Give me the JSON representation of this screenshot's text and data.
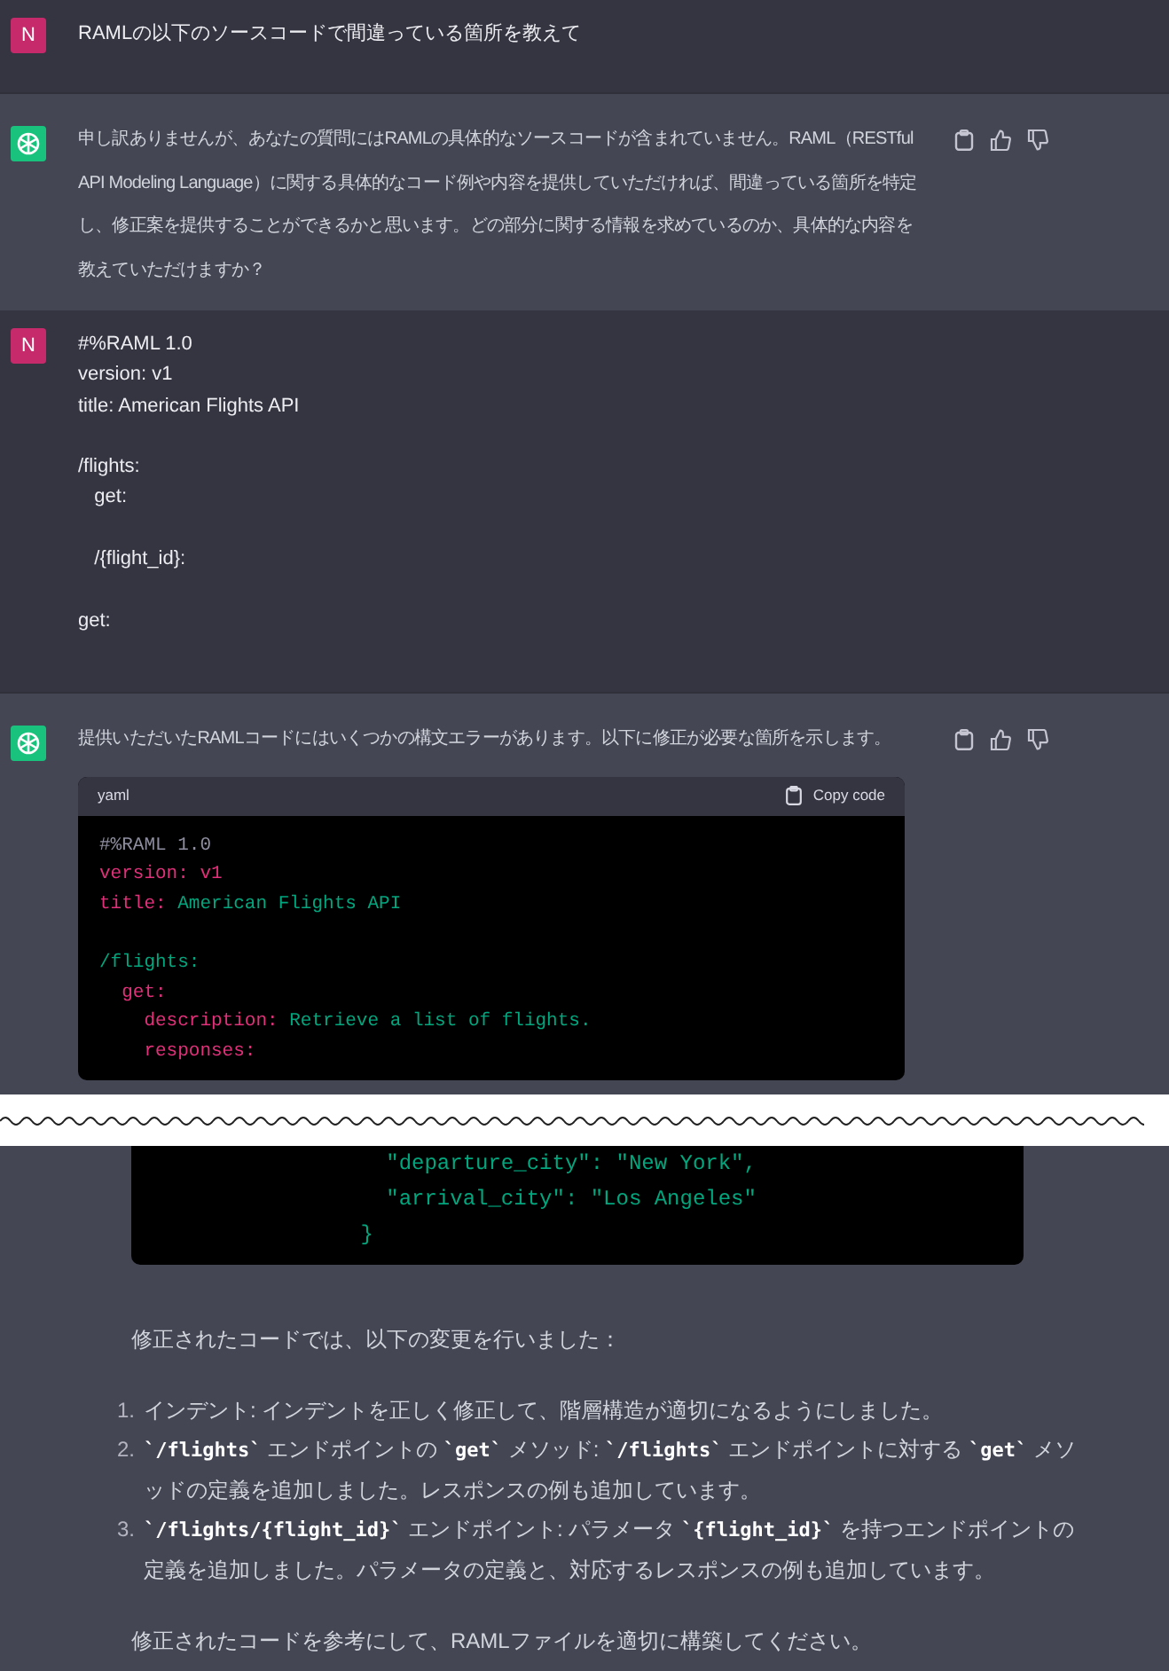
{
  "messages": [
    {
      "kind": "user",
      "avatar_letter": "N",
      "text": "RAMLの以下のソースコードで間違っている箇所を教えて"
    },
    {
      "kind": "assistant",
      "text": "申し訳ありませんが、あなたの質問にはRAMLの具体的なソースコードが含まれていません。RAML（RESTful API Modeling Language）に関する具体的なコード例や内容を提供していただければ、間違っている箇所を特定し、修正案を提供することができるかと思います。どの部分に関する情報を求めているのか、具体的な内容を教えていただけますか？"
    },
    {
      "kind": "user",
      "avatar_letter": "N",
      "text": "#%RAML 1.0\nversion: v1\ntitle: American Flights API\n\n/flights:\n   get:\n\n   /{flight_id}:\n\nget:"
    },
    {
      "kind": "assistant",
      "text": "提供いただいたRAMLコードにはいくつかの構文エラーがあります。以下に修正が必要な箇所を示します。",
      "code_block": {
        "language": "yaml",
        "copy_label": "Copy code",
        "lines": [
          {
            "tokens": [
              {
                "t": "#%RAML 1.0",
                "kind": "comment"
              }
            ]
          },
          {
            "tokens": [
              {
                "t": "version:",
                "kind": "key"
              },
              {
                "t": " v1",
                "kind": "key"
              }
            ]
          },
          {
            "tokens": [
              {
                "t": "title:",
                "kind": "key"
              },
              {
                "t": " American Flights API",
                "kind": "value"
              }
            ]
          },
          {
            "space_before": true,
            "tokens": [
              {
                "t": "/flights:",
                "kind": "value"
              }
            ]
          },
          {
            "tokens": [
              {
                "t": "  get:",
                "kind": "key"
              }
            ]
          },
          {
            "tokens": [
              {
                "t": "    description:",
                "kind": "key"
              },
              {
                "t": " Retrieve a list of flights.",
                "kind": "value"
              }
            ]
          },
          {
            "tokens": [
              {
                "t": "    responses:",
                "kind": "key"
              }
            ]
          }
        ]
      }
    }
  ],
  "continued": {
    "code_lines": [
      {
        "tokens": [
          {
            "t": "                  \"departure_city\": \"New York\",",
            "kind": "value"
          }
        ]
      },
      {
        "tokens": [
          {
            "t": "                  \"arrival_city\": \"Los Angeles\"",
            "kind": "value"
          }
        ]
      },
      {
        "tokens": [
          {
            "t": "                }",
            "kind": "value"
          }
        ]
      }
    ],
    "intro": "修正されたコードでは、以下の変更を行いました：",
    "changes": [
      {
        "number": "1.",
        "parts": [
          {
            "t": "インデント: インデントを正しく修正して、階層構造が適切になるようにしました。",
            "kind": "text"
          }
        ]
      },
      {
        "number": "2.",
        "parts": [
          {
            "t": "`/flights`",
            "kind": "code"
          },
          {
            "t": " エンドポイントの ",
            "kind": "text"
          },
          {
            "t": "`get`",
            "kind": "code"
          },
          {
            "t": " メソッド: ",
            "kind": "text"
          },
          {
            "t": "`/flights`",
            "kind": "code"
          },
          {
            "t": " エンドポイントに対する ",
            "kind": "text"
          },
          {
            "t": "`get`",
            "kind": "code"
          },
          {
            "t": " メソッドの定義を追加しました。レスポンスの例も追加しています。",
            "kind": "text"
          }
        ]
      },
      {
        "number": "3.",
        "parts": [
          {
            "t": "`/flights/{flight_id}`",
            "kind": "code"
          },
          {
            "t": " エンドポイント: パラメータ ",
            "kind": "text"
          },
          {
            "t": "`{flight_id}`",
            "kind": "code"
          },
          {
            "t": " を持つエンドポイントの定義を追加しました。パラメータの定義と、対応するレスポンスの例も追加しています。",
            "kind": "text"
          }
        ]
      }
    ],
    "closing": "修正されたコードを参考にして、RAMLファイルを適切に構築してください。"
  }
}
